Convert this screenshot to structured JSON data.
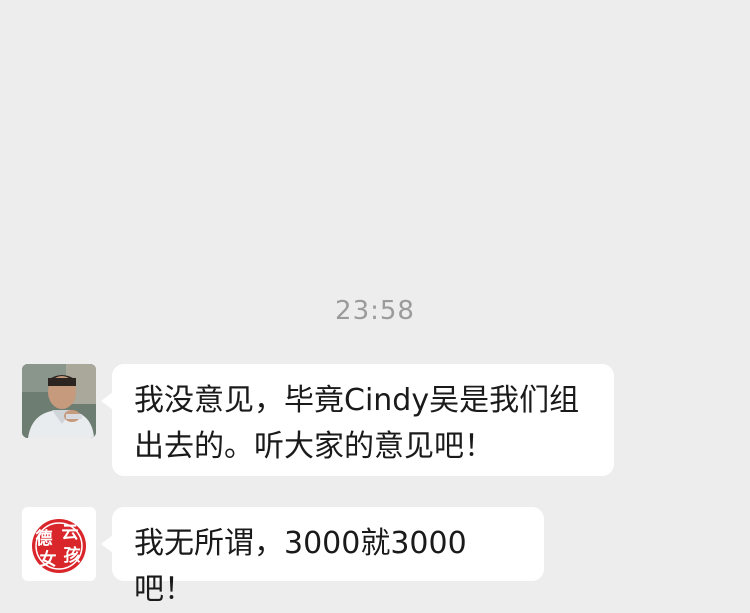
{
  "chat": {
    "timestamp": "23:58",
    "messages": [
      {
        "sender_avatar": "man-photo-avatar",
        "text": "我没意见，毕竟Cindy吴是我们组出去的。听大家的意见吧！"
      },
      {
        "sender_avatar": "deyun-girl-logo-avatar",
        "avatar_logo_text": [
          "德",
          "云",
          "女",
          "孩"
        ],
        "text": "我无所谓，3000就3000吧！"
      }
    ]
  },
  "colors": {
    "background": "#ededed",
    "bubble": "#ffffff",
    "timestamp": "#9b9b9b",
    "text": "#1a1a1a",
    "logo_red": "#d9262b"
  }
}
